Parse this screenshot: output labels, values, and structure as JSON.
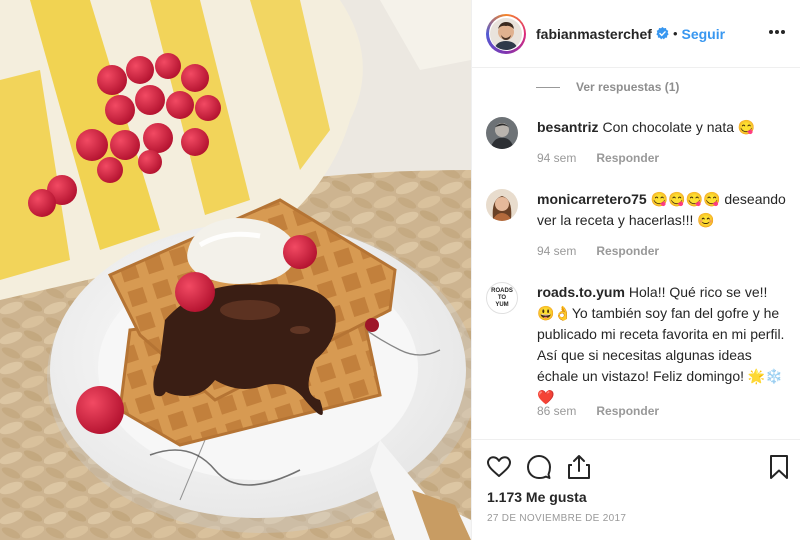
{
  "post": {
    "username": "fabianmasterchef",
    "follow_label": "Seguir",
    "separator": "•",
    "verified_icon": "verified-badge-icon",
    "more_icon": "more-options-icon"
  },
  "comments": {
    "view_replies": "Ver respuestas (1)",
    "items": [
      {
        "user": "besantriz",
        "text": "Con chocolate y nata 😋",
        "time": "94 sem",
        "reply": "Responder"
      },
      {
        "user": "monicarretero75",
        "text": "😋😋😋😋 deseando ver la receta y hacerlas!!! 😊",
        "time": "94 sem",
        "reply": "Responder"
      },
      {
        "user": "roads.to.yum",
        "text": "Hola!! Qué rico se ve!! 😃👌Yo también soy fan del gofre y he publicado mi receta favorita en mi perfil. Así que si necesitas algunas ideas échale un vistazo! Feliz domingo! 🌟❄️❤️",
        "time": "86 sem",
        "reply": "Responder"
      }
    ],
    "roads_avatar_text": "ROADS TO YUM"
  },
  "actions": {
    "likes": "1.173 Me gusta",
    "date": "27 DE NOVIEMBRE DE 2017",
    "icons": [
      "heart-icon",
      "comment-icon",
      "share-icon",
      "bookmark-icon"
    ]
  },
  "colors": {
    "accent": "#3897f0",
    "text": "#262626",
    "muted": "#999999"
  }
}
